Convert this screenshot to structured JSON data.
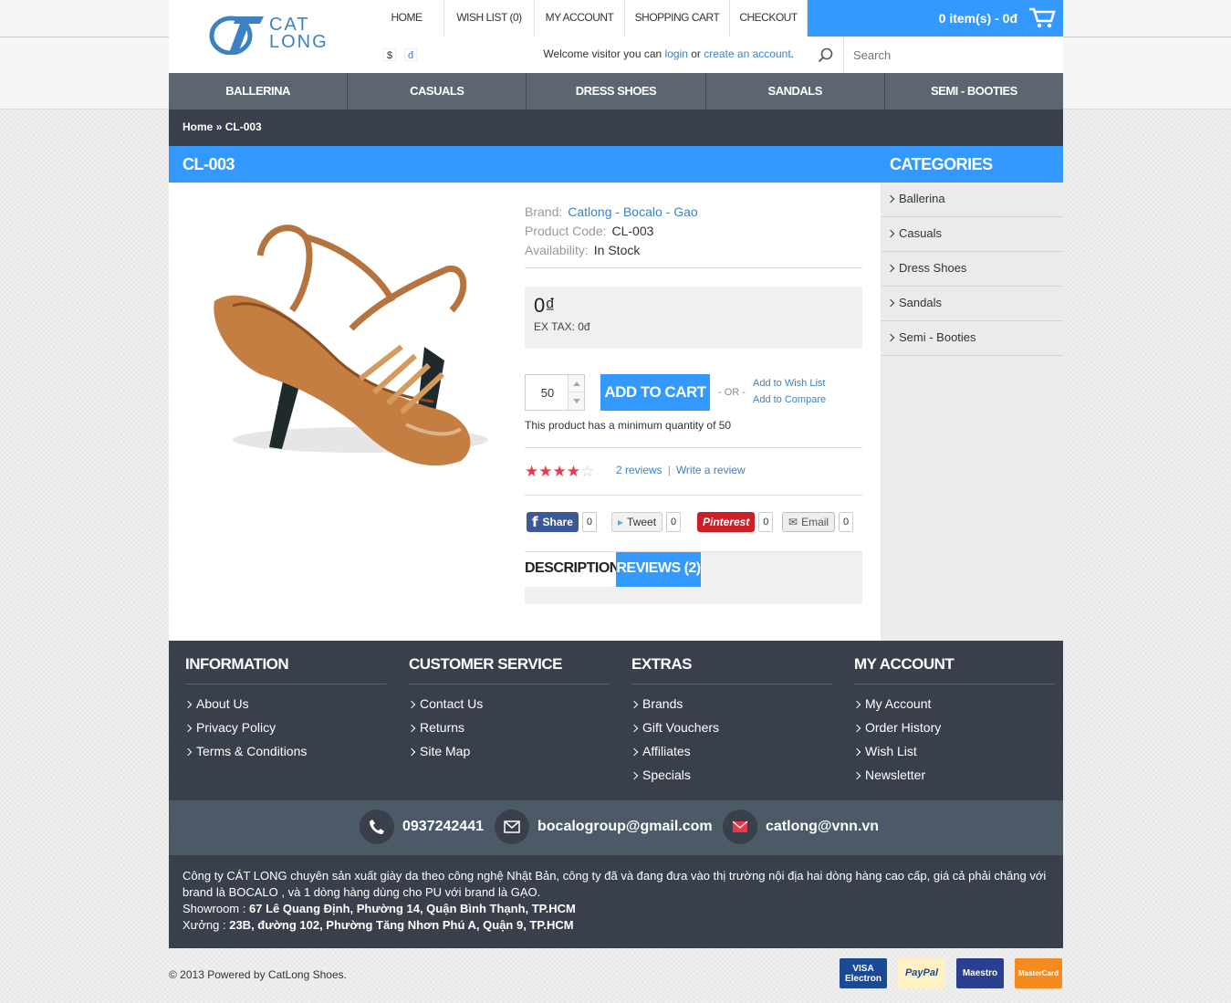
{
  "brand": {
    "logo_line1": "CAT",
    "logo_line2": "LONG"
  },
  "top_nav": [
    "HOME",
    "WISH LIST (0)",
    "MY ACCOUNT",
    "SHOPPING CART",
    "CHECKOUT"
  ],
  "cart": {
    "summary": "0 item(s) - 0đ"
  },
  "currency": {
    "usd": "$",
    "vnd": "đ"
  },
  "welcome": {
    "prefix": "Welcome visitor you can",
    "login": "login",
    "or": "or",
    "create": "create an account",
    "suffix": "."
  },
  "search": {
    "placeholder": "Search"
  },
  "main_nav": [
    "BALLERINA",
    "CASUALS",
    "DRESS SHOES",
    "SANDALS",
    "SEMI - BOOTIES"
  ],
  "breadcrumb": {
    "home": "Home",
    "sep": "»",
    "current": "CL-003"
  },
  "product": {
    "title": "CL-003",
    "brand_label": "Brand:",
    "brand": "Catlong - Bocalo - Gao",
    "code_label": "Product Code:",
    "code": "CL-003",
    "availability_label": "Availability:",
    "availability": "In Stock",
    "price": "0₫",
    "ex_tax": "EX TAX: 0đ",
    "qty": "50",
    "add_to_cart": "ADD TO CART",
    "or": "- OR -",
    "wish_link": "Add to Wish List",
    "compare_link": "Add to Compare",
    "min_qty": "This product has a minimum quantity of 50",
    "rating": 4,
    "rating_max": 5,
    "reviews": "2 reviews",
    "write_review": "Write a review",
    "tabs": [
      "DESCRIPTION",
      "REVIEWS (2)"
    ]
  },
  "share": [
    {
      "label": "Share",
      "count": "0"
    },
    {
      "label": "Tweet",
      "count": "0"
    },
    {
      "label": "Pinterest",
      "count": "0"
    },
    {
      "label": "Email",
      "count": "0"
    }
  ],
  "categories": {
    "title": "CATEGORIES",
    "items": [
      "Ballerina",
      "Casuals",
      "Dress Shoes",
      "Sandals",
      "Semi - Booties"
    ]
  },
  "footer": {
    "columns": [
      {
        "title": "INFORMATION",
        "links": [
          "About Us",
          "Privacy Policy",
          "Terms & Conditions"
        ]
      },
      {
        "title": "CUSTOMER SERVICE",
        "links": [
          "Contact Us",
          "Returns",
          "Site Map"
        ]
      },
      {
        "title": "EXTRAS",
        "links": [
          "Brands",
          "Gift Vouchers",
          "Affiliates",
          "Specials"
        ]
      },
      {
        "title": "MY ACCOUNT",
        "links": [
          "My Account",
          "Order History",
          "Wish List",
          "Newsletter"
        ]
      }
    ],
    "phone": "0937242441",
    "email1": "bocalogroup@gmail.com",
    "email2": "catlong@vnn.vn",
    "about_text": "Công ty CÁT LONG chuyên sản xuất giày da theo công nghệ Nhật Bản, công ty đã và đang đưa vào thị trường nội địa hai dòng hàng cao cấp, giá cả phải chăng với brand là BOCALO , và 1 dòng hàng dùng cho PU với brand là GẠO.",
    "showroom_label": "Showroom :",
    "showroom": "67 Lê Quang Định, Phường 14, Quận Bình Thạnh, TP.HCM",
    "workshop_label": "Xưởng :",
    "workshop": "23B, đường 102, Phường Tăng Nhơn Phú A, Quận 9, TP.HCM",
    "copyright": "© 2013 Powered by CatLong Shoes.",
    "cards": [
      "VISA Electron",
      "PayPal",
      "Maestro",
      "MasterCard"
    ]
  },
  "colors": {
    "accent": "#3399ff",
    "dark": "#3a3f4c",
    "nav": "#5d6570",
    "link": "#3b82c4",
    "star": "#e73b4e"
  }
}
